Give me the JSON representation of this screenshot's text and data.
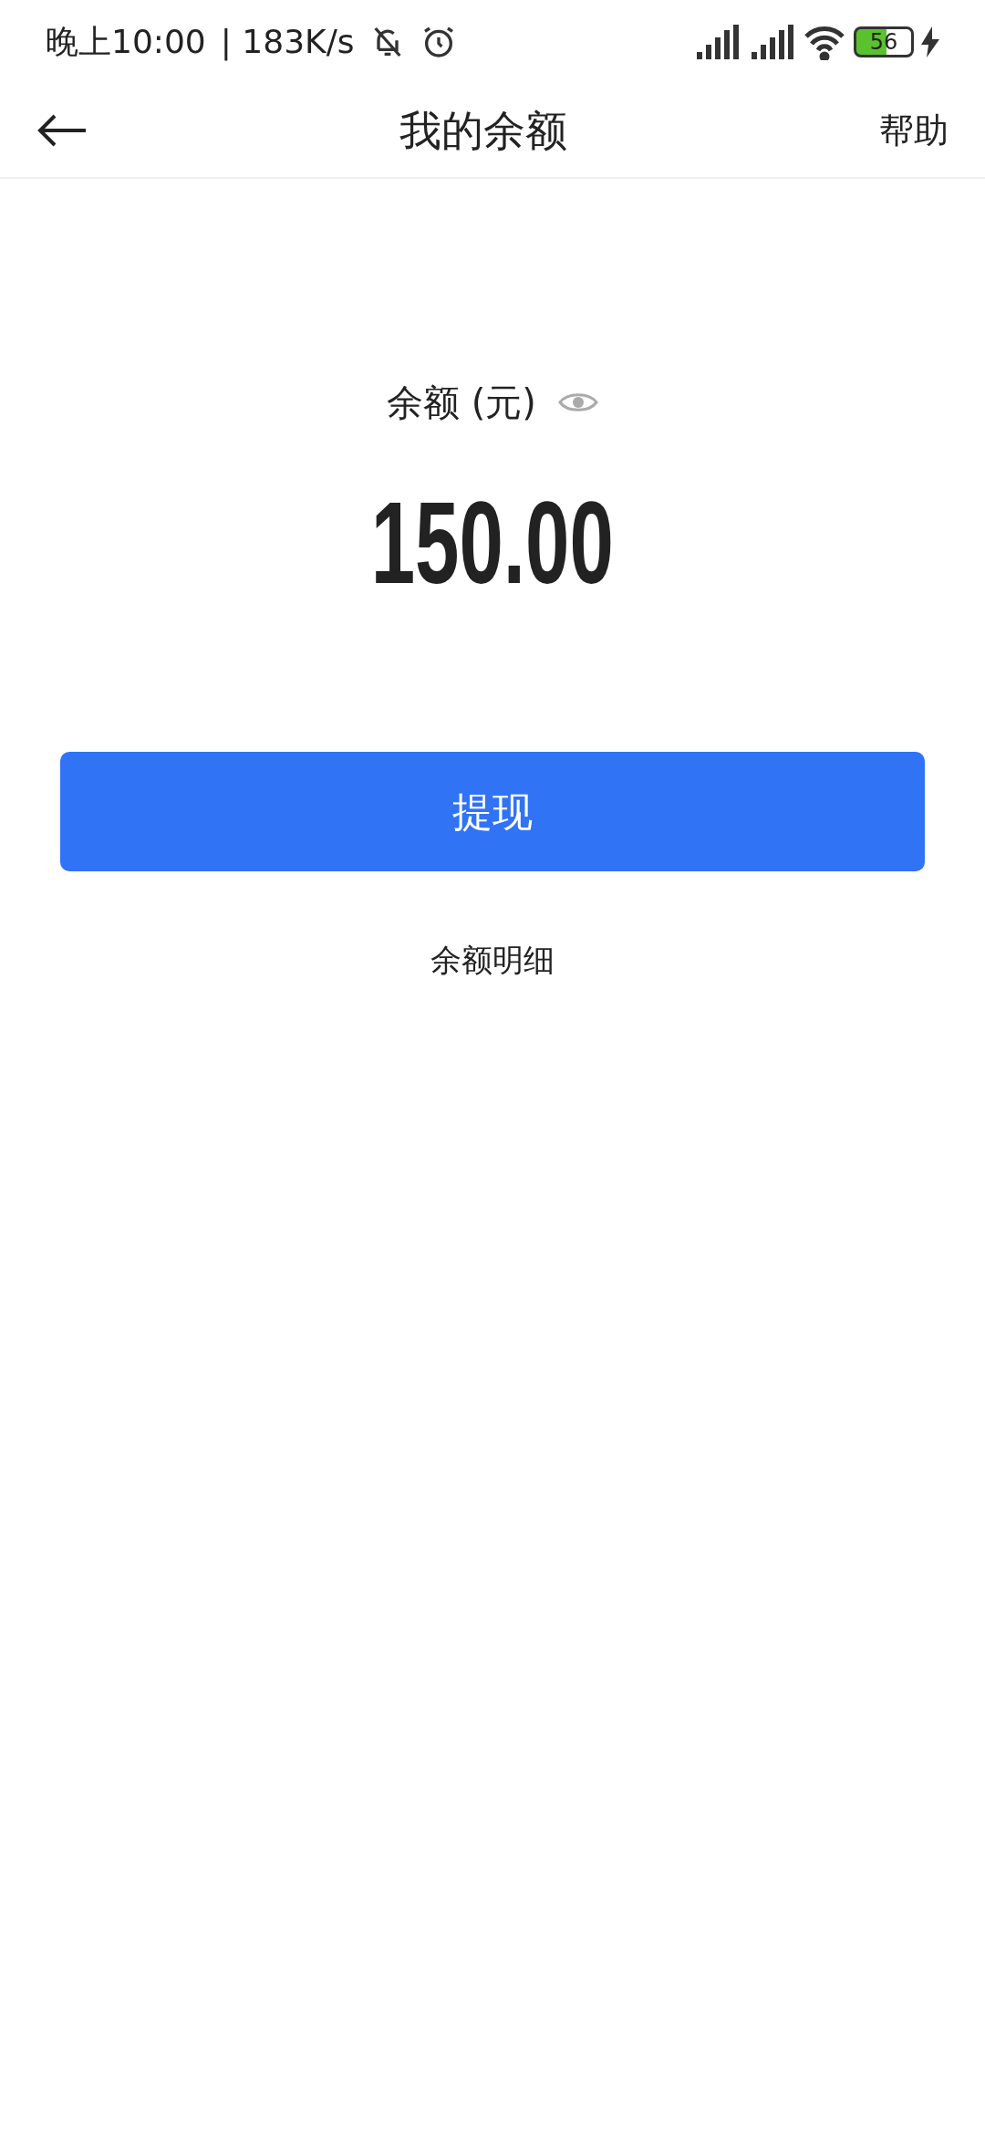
{
  "status_bar": {
    "time": "晚上10:00",
    "speed": "| 183K/s",
    "battery": "56"
  },
  "header": {
    "title": "我的余额",
    "action": "帮助"
  },
  "balance": {
    "label": "余额 (元)",
    "amount": "150.00"
  },
  "withdraw_button": "提现",
  "details_link": "余额明细"
}
